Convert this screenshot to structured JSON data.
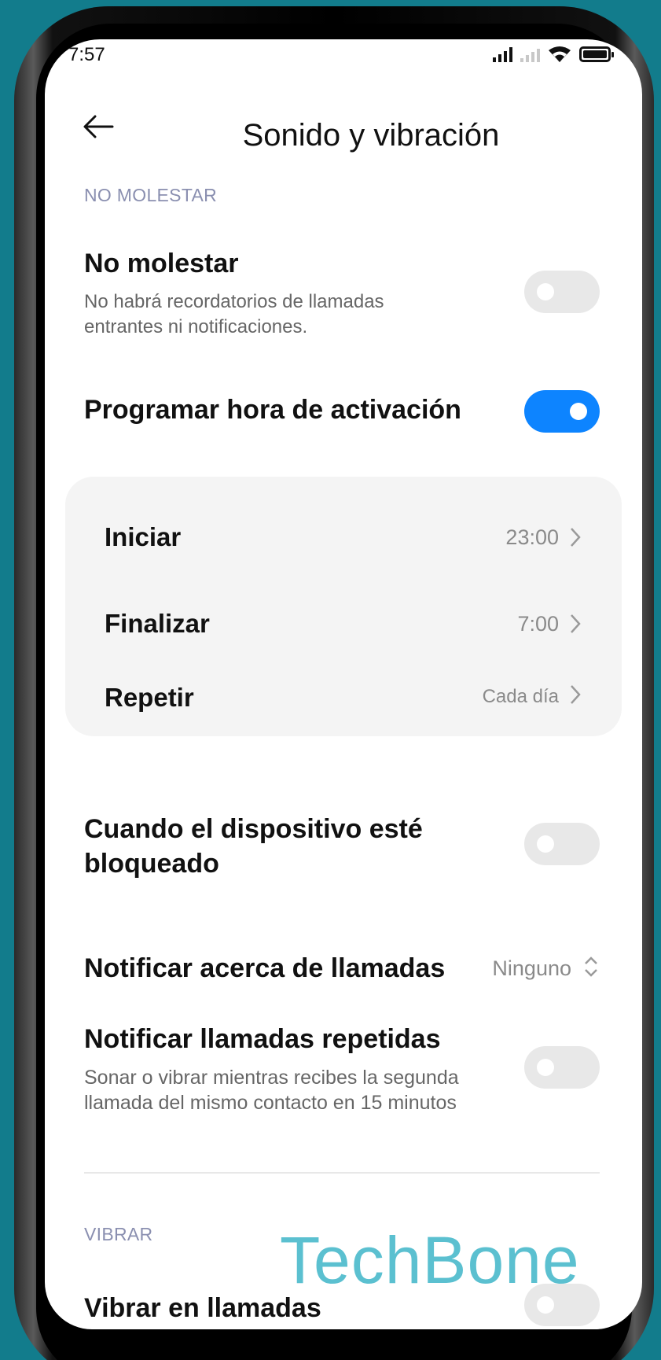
{
  "status_bar": {
    "time": "7:57"
  },
  "header": {
    "title": "Sonido y vibración"
  },
  "dnd_section": {
    "label": "NO MOLESTAR",
    "dnd": {
      "title": "No molestar",
      "subtitle_line1": "No habrá recordatorios de llamadas",
      "subtitle_line2": "entrantes ni notificaciones.",
      "enabled": false
    },
    "schedule": {
      "title": "Programar hora de activación",
      "enabled": true
    },
    "schedule_card": {
      "start": {
        "label": "Iniciar",
        "value": "23:00"
      },
      "end": {
        "label": "Finalizar",
        "value": "7:00"
      },
      "repeat": {
        "label": "Repetir",
        "value": "Cada día"
      }
    },
    "locked": {
      "title_line1": "Cuando el dispositivo esté",
      "title_line2": "bloqueado",
      "enabled": false
    },
    "notify_calls": {
      "title": "Notificar acerca de llamadas",
      "value": "Ninguno"
    },
    "repeat_calls": {
      "title": "Notificar llamadas repetidas",
      "subtitle_line1": "Sonar o vibrar mientras recibes la segunda",
      "subtitle_line2": "llamada del mismo contacto en 15 minutos",
      "enabled": false
    }
  },
  "vibrate_section": {
    "label": "VIBRAR",
    "vibrate_calls": {
      "title": "Vibrar en llamadas",
      "enabled": false
    }
  },
  "watermark": "TechBone",
  "colors": {
    "accent": "#0d84ff",
    "background": "#127c8c",
    "watermark": "#5bc0d0"
  }
}
